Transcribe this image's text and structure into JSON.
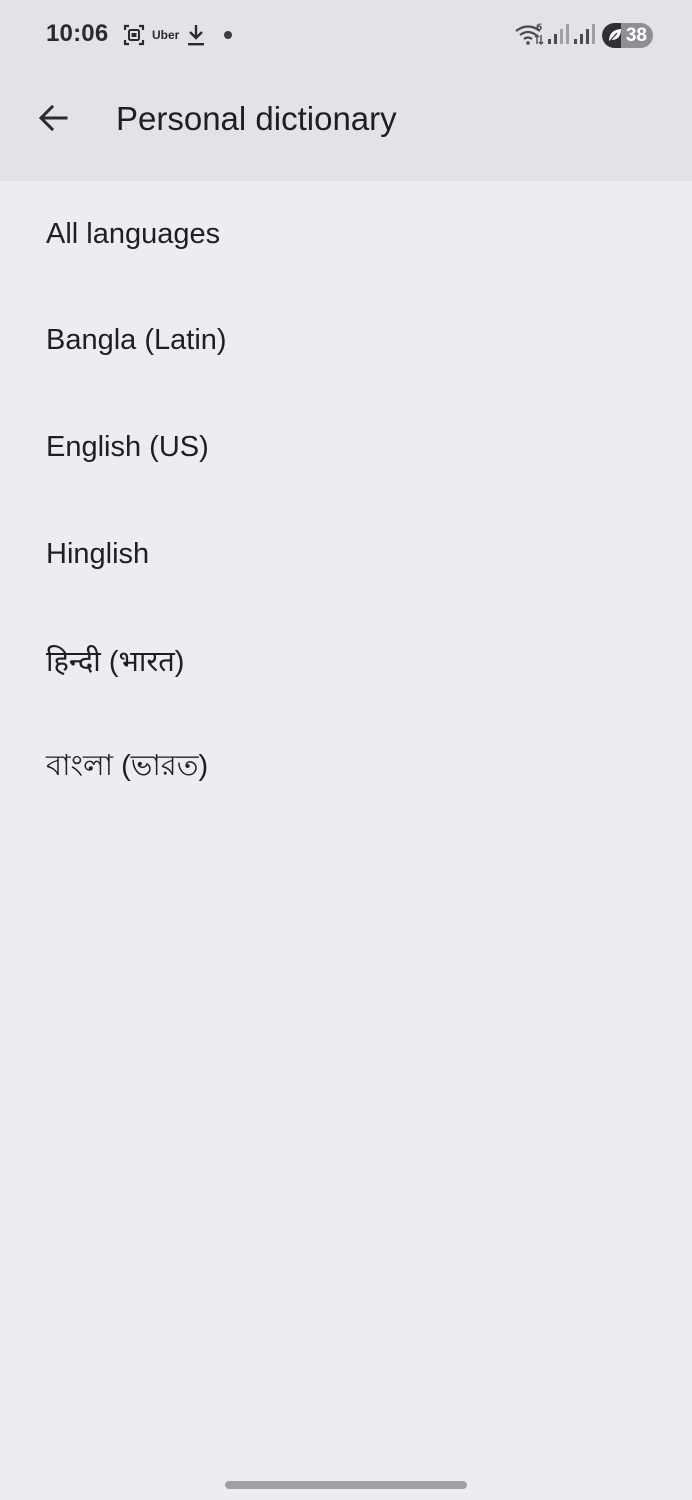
{
  "status_bar": {
    "time": "10:06",
    "notification_app": "Uber",
    "battery_level": "38",
    "icons": [
      "screenshot-icon",
      "uber-icon",
      "download-icon",
      "notification-dot",
      "wifi-icon",
      "signal-icon",
      "signal-icon",
      "battery-saver-icon"
    ]
  },
  "app_bar": {
    "title": "Personal dictionary",
    "back_icon": "arrow-back-icon"
  },
  "languages": [
    {
      "label": "All languages"
    },
    {
      "label": "Bangla (Latin)"
    },
    {
      "label": "English (US)"
    },
    {
      "label": "Hinglish"
    },
    {
      "label": "हिन्दी (भारत)"
    },
    {
      "label": "বাংলা (ভারত)"
    }
  ],
  "colors": {
    "background": "#ecedf2",
    "topbar": "#e2e3e8",
    "text": "#1f1f22"
  }
}
